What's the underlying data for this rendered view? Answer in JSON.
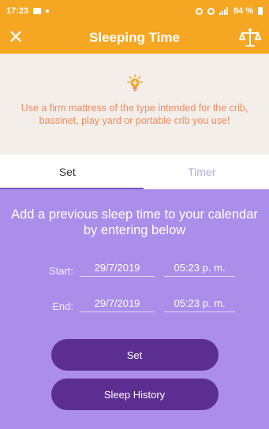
{
  "status": {
    "time": "17:23",
    "battery": "84 %"
  },
  "app_bar": {
    "title": "Sleeping Time",
    "close_icon": "close-icon",
    "right_icon": "scale-icon"
  },
  "tip": {
    "icon": "lightbulb-icon",
    "text": "Use a firm mattress of the type intended for the crib, bassinet, play yard or portable crib you use!"
  },
  "tabs": [
    {
      "label": "Set",
      "active": true
    },
    {
      "label": "Timer",
      "active": false
    }
  ],
  "form": {
    "heading": "Add a previous sleep time to your calendar by entering below",
    "start": {
      "label": "Start:",
      "date": "29/7/2019",
      "time": "05:23 p. m."
    },
    "end": {
      "label": "End:",
      "date": "29/7/2019",
      "time": "05:23 p. m."
    },
    "set_button": "Set",
    "history_button": "Sleep History"
  },
  "colors": {
    "header": "#f5a623",
    "tip_bg": "#f3eee9",
    "tip_text": "#f08a5d",
    "panel": "#ab8dea",
    "button": "#5c2e91",
    "tab_active_line": "#7a5bc7"
  }
}
